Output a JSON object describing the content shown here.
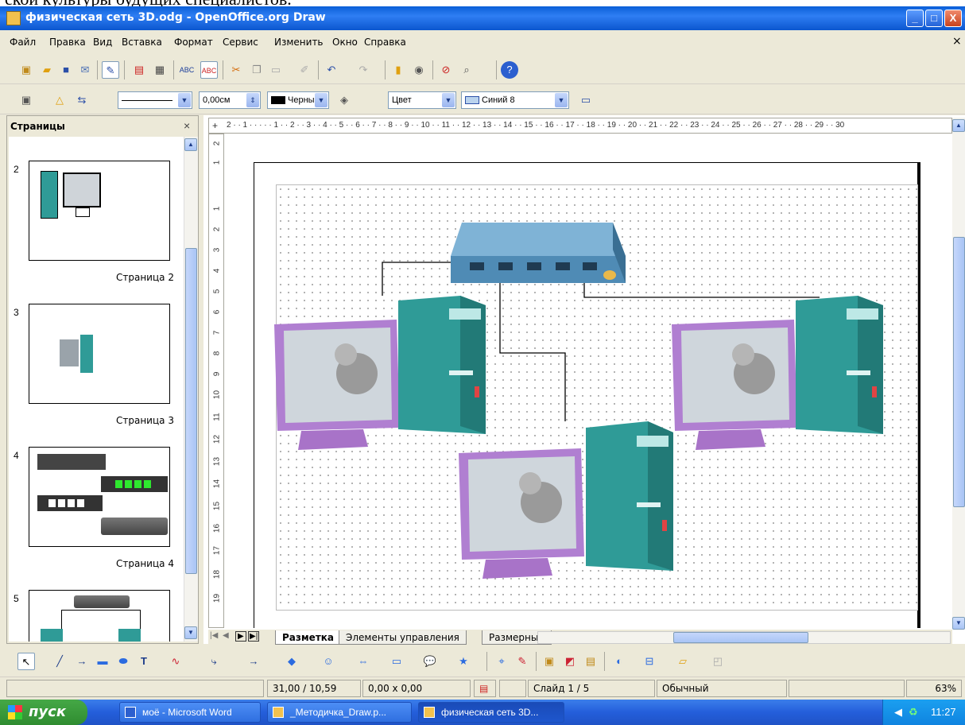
{
  "doc_strip": {
    "text": "ской культуры будущих специалистов."
  },
  "window": {
    "title": "физическая сеть 3D.odg - OpenOffice.org Draw",
    "btn_min": "_",
    "btn_max": "□",
    "btn_close": "X"
  },
  "menu": {
    "items": [
      "Файл",
      "Правка",
      "Вид",
      "Вставка",
      "Формат",
      "Сервис",
      "Изменить",
      "Окно",
      "Справка"
    ],
    "close": "×"
  },
  "line_toolbar": {
    "line_width": "0,00см",
    "line_color": "Черный",
    "area_style": "Цвет",
    "area_color": "Синий 8"
  },
  "pages_panel": {
    "title": "Страницы",
    "close": "×",
    "pages": [
      {
        "num": "2",
        "caption": "Страница 2"
      },
      {
        "num": "3",
        "caption": "Страница 3"
      },
      {
        "num": "4",
        "caption": "Страница 4"
      },
      {
        "num": "5",
        "caption": ""
      }
    ]
  },
  "ruler": {
    "h_ticks": "2 · · 1 · · ·   · · 1 · · 2 · · 3 · · 4 · · 5 · · 6 · · 7 · · 8 · · 9 · · 10 · · 11 · · 12 · · 13 · · 14 · · 15 · · 16 · · 17 · · 18 · · 19 · · 20 · · 21 · · 22 · · 23 · · 24 · · 25 · · 26 · · 27 · · 28 · · 29 · · 30",
    "v_ticks": [
      "2",
      "1",
      "1",
      "2",
      "3",
      "4",
      "5",
      "6",
      "7",
      "8",
      "9",
      "10",
      "11",
      "12",
      "13",
      "14",
      "15",
      "16",
      "17",
      "18",
      "19"
    ]
  },
  "tabs": {
    "items": [
      "Разметка",
      "Элементы управления",
      "Размерные"
    ]
  },
  "status": {
    "position": "31,00 / 10,59",
    "size": "0,00 x 0,00",
    "slide": "Слайд 1 / 5",
    "layout": "Обычный",
    "zoom": "63%"
  },
  "taskbar": {
    "start": "пуск",
    "tasks": [
      "моё - Microsoft Word",
      "_Методичка_Draw.p...",
      "физическая сеть 3D..."
    ],
    "clock": "11:27"
  },
  "colors": {
    "title_bar": "#0b56cf",
    "monitor": "#b07fd1",
    "pc_tower": "#2f9b97",
    "switch": "#5f9bc1"
  }
}
